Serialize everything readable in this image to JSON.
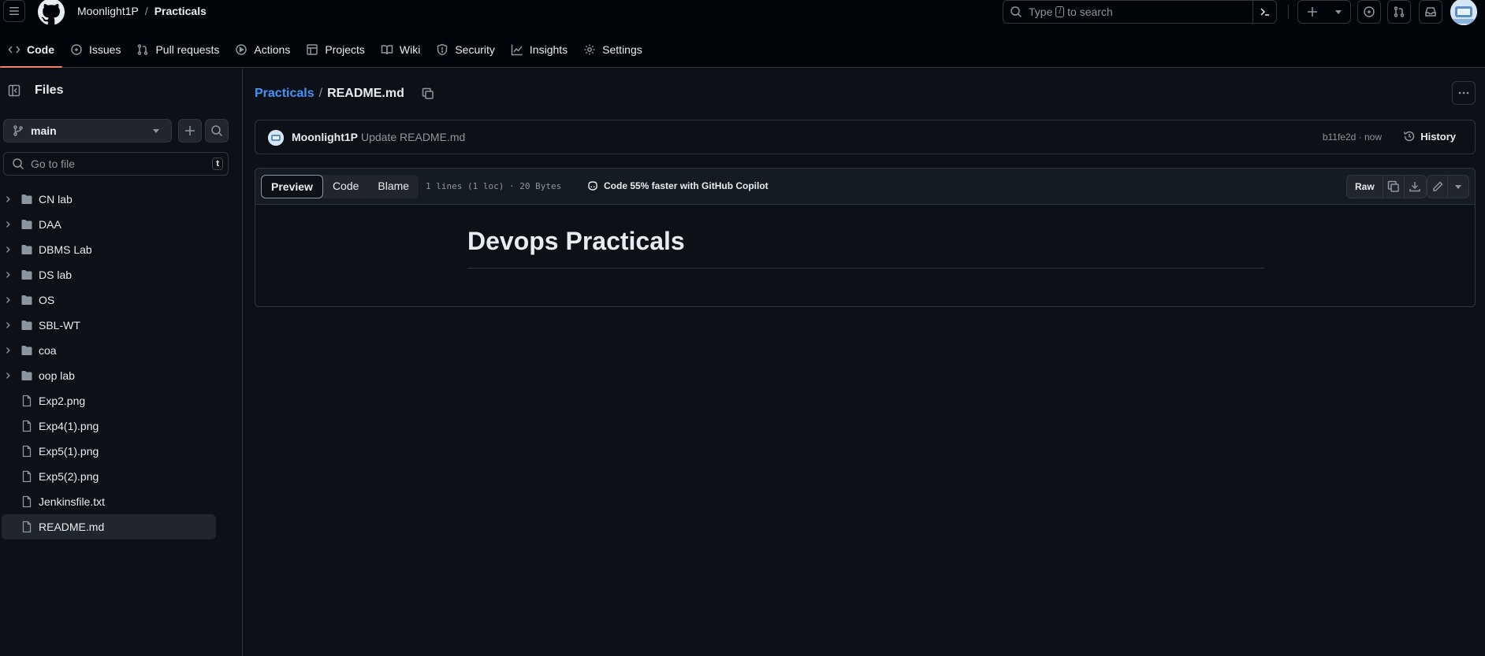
{
  "header": {
    "owner": "Moonlight1P",
    "separator": "/",
    "repo": "Practicals",
    "search_prefix": "Type",
    "search_key": "/",
    "search_suffix": "to search"
  },
  "tabs": [
    {
      "label": "Code",
      "icon": "code-icon",
      "active": true
    },
    {
      "label": "Issues",
      "icon": "issue-opened-icon"
    },
    {
      "label": "Pull requests",
      "icon": "git-pull-request-icon"
    },
    {
      "label": "Actions",
      "icon": "play-icon"
    },
    {
      "label": "Projects",
      "icon": "table-icon"
    },
    {
      "label": "Wiki",
      "icon": "book-icon"
    },
    {
      "label": "Security",
      "icon": "shield-icon"
    },
    {
      "label": "Insights",
      "icon": "graph-icon"
    },
    {
      "label": "Settings",
      "icon": "gear-icon"
    }
  ],
  "sidebar": {
    "title": "Files",
    "branch": "main",
    "go_to_file_placeholder": "Go to file",
    "go_to_file_key": "t",
    "items": [
      {
        "label": "CN lab",
        "type": "folder"
      },
      {
        "label": "DAA",
        "type": "folder"
      },
      {
        "label": "DBMS Lab",
        "type": "folder"
      },
      {
        "label": "DS lab",
        "type": "folder"
      },
      {
        "label": "OS",
        "type": "folder"
      },
      {
        "label": "SBL-WT",
        "type": "folder"
      },
      {
        "label": "coa",
        "type": "folder"
      },
      {
        "label": "oop lab",
        "type": "folder"
      },
      {
        "label": "Exp2.png",
        "type": "file"
      },
      {
        "label": "Exp4(1).png",
        "type": "file"
      },
      {
        "label": "Exp5(1).png",
        "type": "file"
      },
      {
        "label": "Exp5(2).png",
        "type": "file"
      },
      {
        "label": "Jenkinsfile.txt",
        "type": "file"
      },
      {
        "label": "README.md",
        "type": "file",
        "selected": true
      }
    ]
  },
  "breadcrumb": {
    "repo": "Practicals",
    "separator": "/",
    "file": "README.md"
  },
  "commit": {
    "author": "Moonlight1P",
    "message": "Update README.md",
    "sha_time": "b11fe2d · now",
    "history_label": "History"
  },
  "file_view": {
    "tabs": [
      "Preview",
      "Code",
      "Blame"
    ],
    "active_tab": "Preview",
    "info": "1 lines (1 loc) · 20 Bytes",
    "copilot_text": "Code 55% faster with GitHub Copilot",
    "raw_label": "Raw"
  },
  "readme": {
    "heading": "Devops Practicals"
  },
  "colors": {
    "background": "#0d1117",
    "header_bg": "#010409",
    "accent_link": "#4493f8",
    "active_tab_underline": "#f78166",
    "border": "#30363d"
  }
}
